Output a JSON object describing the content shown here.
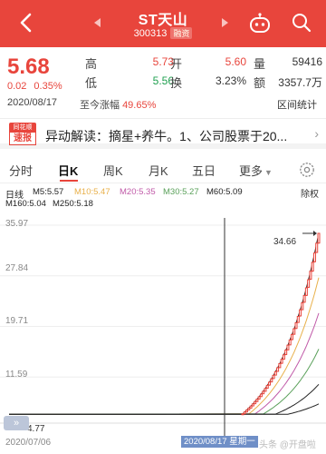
{
  "header": {
    "title": "ST天山",
    "code": "300313",
    "badge": "融资",
    "back_icon": "chevron-left-icon",
    "prev_icon": "triangle-left-icon",
    "next_icon": "triangle-right-icon",
    "robot_icon": "robot-icon",
    "search_icon": "search-icon"
  },
  "quote": {
    "price": "5.68",
    "change": "0.02",
    "change_pct": "0.35%",
    "rows": [
      {
        "l1": "高",
        "v1": "5.73",
        "l2": "开",
        "v2": "5.60",
        "l3": "量",
        "v3": "59416"
      },
      {
        "l1": "低",
        "v1": "5.56",
        "l2": "换",
        "v2": "3.23%",
        "l3": "额",
        "v3": "3357.7万"
      }
    ],
    "date": "2020/08/17",
    "range_label": "至今涨幅",
    "range_value": "49.65%",
    "range_stats": "区间统计"
  },
  "news": {
    "logo_top": "同花顺",
    "logo_bottom": "速报",
    "text": "异动解读：摘星+养牛。1、公司股票于20...",
    "more": "›"
  },
  "tabs": [
    "分时",
    "日K",
    "周K",
    "月K",
    "五日",
    "更多"
  ],
  "active_tab": 1,
  "settings_icon": "gear-icon",
  "ma_legend": {
    "line1": [
      {
        "text": "日线",
        "color": "#222222"
      },
      {
        "text": "M5:5.57",
        "color": "#222222"
      },
      {
        "text": "M10:5.47",
        "color": "#e8b04a"
      },
      {
        "text": "M20:5.35",
        "color": "#c05aa8"
      },
      {
        "text": "M30:5.27",
        "color": "#5aa05a"
      },
      {
        "text": "M60:5.09",
        "color": "#222222"
      }
    ],
    "line2": [
      {
        "text": "M160:5.04",
        "color": "#222222"
      },
      {
        "text": "M250:5.18",
        "color": "#222222"
      }
    ],
    "fuquan": "除权"
  },
  "chart_data": {
    "type": "candlestick",
    "y_ticks": [
      "35.97",
      "27.84",
      "19.71",
      "11.59"
    ],
    "ylim": [
      4.77,
      35.97
    ],
    "max_label": "34.66",
    "min_label": "4.77",
    "start_date": "2020/07/06",
    "cursor_date": "2020/08/17",
    "cursor_week": "星期一",
    "candles": [
      {
        "o": 5.6,
        "c": 5.68,
        "h": 5.73,
        "l": 5.56
      },
      {
        "o": 5.7,
        "c": 5.98,
        "h": 6.0,
        "l": 5.65
      },
      {
        "o": 5.98,
        "c": 6.28,
        "h": 6.3,
        "l": 5.95
      },
      {
        "o": 6.3,
        "c": 6.6,
        "h": 6.62,
        "l": 6.25
      },
      {
        "o": 6.6,
        "c": 6.93,
        "h": 6.95,
        "l": 6.55
      },
      {
        "o": 6.95,
        "c": 7.28,
        "h": 7.3,
        "l": 6.9
      },
      {
        "o": 7.3,
        "c": 7.65,
        "h": 7.7,
        "l": 7.25
      },
      {
        "o": 7.65,
        "c": 8.03,
        "h": 8.05,
        "l": 7.6
      },
      {
        "o": 8.05,
        "c": 8.43,
        "h": 8.45,
        "l": 8.0
      },
      {
        "o": 8.45,
        "c": 8.85,
        "h": 8.9,
        "l": 8.4
      },
      {
        "o": 8.9,
        "c": 9.3,
        "h": 9.3,
        "l": 8.85
      },
      {
        "o": 9.3,
        "c": 9.76,
        "h": 9.8,
        "l": 9.25
      },
      {
        "o": 9.8,
        "c": 10.25,
        "h": 10.3,
        "l": 9.75
      },
      {
        "o": 10.3,
        "c": 10.76,
        "h": 10.8,
        "l": 10.2
      },
      {
        "o": 10.8,
        "c": 11.3,
        "h": 11.35,
        "l": 10.75
      },
      {
        "o": 11.35,
        "c": 11.87,
        "h": 11.9,
        "l": 11.3
      },
      {
        "o": 11.9,
        "c": 12.46,
        "h": 12.5,
        "l": 11.85
      },
      {
        "o": 12.5,
        "c": 13.08,
        "h": 13.1,
        "l": 12.45
      },
      {
        "o": 13.1,
        "c": 13.74,
        "h": 13.8,
        "l": 13.05
      },
      {
        "o": 13.8,
        "c": 14.43,
        "h": 14.45,
        "l": 13.7
      },
      {
        "o": 14.45,
        "c": 15.15,
        "h": 15.2,
        "l": 14.4
      },
      {
        "o": 15.2,
        "c": 15.91,
        "h": 15.95,
        "l": 15.1
      },
      {
        "o": 15.95,
        "c": 16.7,
        "h": 16.75,
        "l": 15.9
      },
      {
        "o": 16.75,
        "c": 17.54,
        "h": 17.6,
        "l": 16.7
      },
      {
        "o": 17.6,
        "c": 18.42,
        "h": 18.45,
        "l": 17.5
      },
      {
        "o": 18.45,
        "c": 19.34,
        "h": 19.4,
        "l": 18.4
      },
      {
        "o": 19.4,
        "c": 20.3,
        "h": 20.35,
        "l": 19.3
      },
      {
        "o": 20.35,
        "c": 21.32,
        "h": 21.4,
        "l": 20.3
      },
      {
        "o": 21.4,
        "c": 22.38,
        "h": 22.4,
        "l": 21.3
      },
      {
        "o": 22.4,
        "c": 23.5,
        "h": 23.6,
        "l": 22.35
      },
      {
        "o": 23.6,
        "c": 24.68,
        "h": 24.7,
        "l": 23.5
      },
      {
        "o": 24.7,
        "c": 25.91,
        "h": 26.0,
        "l": 24.6
      },
      {
        "o": 26.0,
        "c": 27.21,
        "h": 27.3,
        "l": 25.9
      },
      {
        "o": 27.3,
        "c": 28.57,
        "h": 28.6,
        "l": 27.2
      },
      {
        "o": 28.6,
        "c": 30.0,
        "h": 30.1,
        "l": 28.5
      },
      {
        "o": 30.1,
        "c": 31.5,
        "h": 31.6,
        "l": 30.0
      },
      {
        "o": 31.6,
        "c": 33.08,
        "h": 33.1,
        "l": 31.5
      },
      {
        "o": 33.1,
        "c": 34.66,
        "h": 34.66,
        "l": 33.0
      }
    ]
  },
  "controls": {
    "fast_back": "»",
    "watermark": "头条 @开盘啦"
  }
}
